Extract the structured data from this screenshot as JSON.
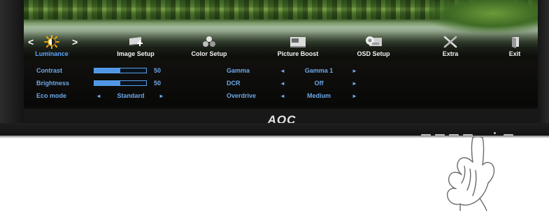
{
  "menu": {
    "nav_left": "<",
    "nav_right": ">",
    "items": [
      {
        "label": "Luminance",
        "icon": "sun-brightness-icon",
        "active": true
      },
      {
        "label": "Image Setup",
        "icon": "image-setup-icon",
        "active": false
      },
      {
        "label": "Color Setup",
        "icon": "color-setup-icon",
        "active": false
      },
      {
        "label": "Picture Boost",
        "icon": "picture-boost-icon",
        "active": false
      },
      {
        "label": "OSD Setup",
        "icon": "osd-setup-icon",
        "active": false
      },
      {
        "label": "Extra",
        "icon": "extra-tools-icon",
        "active": false
      },
      {
        "label": "Exit",
        "icon": "exit-icon",
        "active": false
      }
    ]
  },
  "settings": {
    "contrast": {
      "label": "Contrast",
      "value": "50",
      "level": 0.5
    },
    "brightness": {
      "label": "Brightness",
      "value": "50",
      "level": 0.5
    },
    "eco_mode": {
      "label": "Eco mode",
      "value": "Standard"
    },
    "gamma": {
      "label": "Gamma",
      "value": "Gamma 1"
    },
    "dcr": {
      "label": "DCR",
      "value": "Off"
    },
    "overdrive": {
      "label": "Overdrive",
      "value": "Medium"
    }
  },
  "arrows": {
    "left": "◄",
    "right": "►"
  },
  "brand": {
    "logo": "AOC"
  },
  "colors": {
    "accent": "#5aa6ff",
    "label": "#6ea8e8",
    "active_icon": "#ffb400"
  }
}
